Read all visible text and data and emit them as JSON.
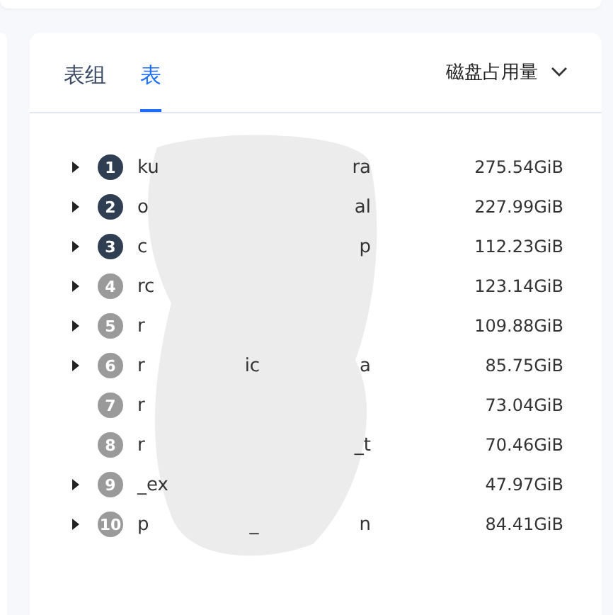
{
  "tabs": [
    {
      "label": "表组",
      "selected": false
    },
    {
      "label": "表",
      "selected": true
    }
  ],
  "sort": {
    "label": "磁盘占用量"
  },
  "rows": [
    {
      "rank": "1",
      "top": true,
      "expandable": true,
      "name_fragments": [
        "ku",
        "ra"
      ],
      "size": "275.54GiB"
    },
    {
      "rank": "2",
      "top": true,
      "expandable": true,
      "name_fragments": [
        "o",
        "al"
      ],
      "size": "227.99GiB"
    },
    {
      "rank": "3",
      "top": true,
      "expandable": true,
      "name_fragments": [
        "c",
        "p"
      ],
      "size": "112.23GiB"
    },
    {
      "rank": "4",
      "top": false,
      "expandable": true,
      "name_fragments": [
        "rc"
      ],
      "size": "123.14GiB"
    },
    {
      "rank": "5",
      "top": false,
      "expandable": true,
      "name_fragments": [
        "r"
      ],
      "size": "109.88GiB"
    },
    {
      "rank": "6",
      "top": false,
      "expandable": true,
      "name_fragments": [
        "r",
        "ic",
        "a"
      ],
      "size": "85.75GiB"
    },
    {
      "rank": "7",
      "top": false,
      "expandable": false,
      "name_fragments": [
        "r"
      ],
      "size": "73.04GiB"
    },
    {
      "rank": "8",
      "top": false,
      "expandable": false,
      "name_fragments": [
        "r",
        "_t"
      ],
      "size": "70.46GiB"
    },
    {
      "rank": "9",
      "top": false,
      "expandable": true,
      "name_fragments": [
        "_ex"
      ],
      "size": "47.97GiB"
    },
    {
      "rank": "10",
      "top": false,
      "expandable": true,
      "name_fragments": [
        "p",
        "_",
        "n"
      ],
      "size": "84.41GiB"
    }
  ]
}
